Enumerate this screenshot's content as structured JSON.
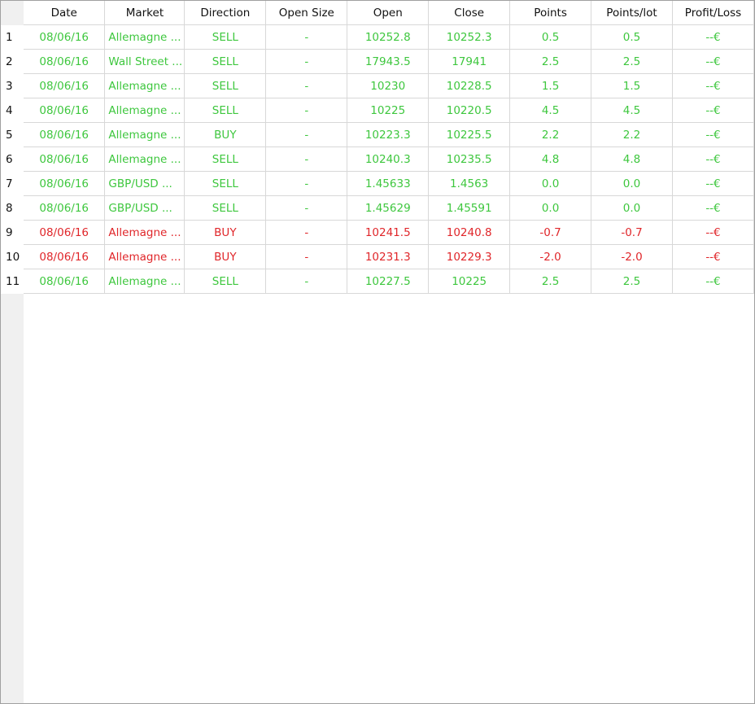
{
  "columns": [
    "Date",
    "Market",
    "Direction",
    "Open Size",
    "Open",
    "Close",
    "Points",
    "Points/lot",
    "Profit/Loss"
  ],
  "colors": {
    "win": "#3ec73e",
    "loss": "#e0262a"
  },
  "rows": [
    {
      "num": "1",
      "result": "win",
      "date": "08/06/16",
      "market": "Allemagne ...",
      "direction": "SELL",
      "open_size": "-",
      "open": "10252.8",
      "close": "10252.3",
      "points": "0.5",
      "points_lot": "0.5",
      "pl": "--€"
    },
    {
      "num": "2",
      "result": "win",
      "date": "08/06/16",
      "market": "Wall Street ...",
      "direction": "SELL",
      "open_size": "-",
      "open": "17943.5",
      "close": "17941",
      "points": "2.5",
      "points_lot": "2.5",
      "pl": "--€"
    },
    {
      "num": "3",
      "result": "win",
      "date": "08/06/16",
      "market": "Allemagne ...",
      "direction": "SELL",
      "open_size": "-",
      "open": "10230",
      "close": "10228.5",
      "points": "1.5",
      "points_lot": "1.5",
      "pl": "--€"
    },
    {
      "num": "4",
      "result": "win",
      "date": "08/06/16",
      "market": "Allemagne ...",
      "direction": "SELL",
      "open_size": "-",
      "open": "10225",
      "close": "10220.5",
      "points": "4.5",
      "points_lot": "4.5",
      "pl": "--€"
    },
    {
      "num": "5",
      "result": "win",
      "date": "08/06/16",
      "market": "Allemagne ...",
      "direction": "BUY",
      "open_size": "-",
      "open": "10223.3",
      "close": "10225.5",
      "points": "2.2",
      "points_lot": "2.2",
      "pl": "--€"
    },
    {
      "num": "6",
      "result": "win",
      "date": "08/06/16",
      "market": "Allemagne ...",
      "direction": "SELL",
      "open_size": "-",
      "open": "10240.3",
      "close": "10235.5",
      "points": "4.8",
      "points_lot": "4.8",
      "pl": "--€"
    },
    {
      "num": "7",
      "result": "win",
      "date": "08/06/16",
      "market": "GBP/USD ...",
      "direction": "SELL",
      "open_size": "-",
      "open": "1.45633",
      "close": "1.4563",
      "points": "0.0",
      "points_lot": "0.0",
      "pl": "--€"
    },
    {
      "num": "8",
      "result": "win",
      "date": "08/06/16",
      "market": "GBP/USD ...",
      "direction": "SELL",
      "open_size": "-",
      "open": "1.45629",
      "close": "1.45591",
      "points": "0.0",
      "points_lot": "0.0",
      "pl": "--€"
    },
    {
      "num": "9",
      "result": "loss",
      "date": "08/06/16",
      "market": "Allemagne ...",
      "direction": "BUY",
      "open_size": "-",
      "open": "10241.5",
      "close": "10240.8",
      "points": "-0.7",
      "points_lot": "-0.7",
      "pl": "--€"
    },
    {
      "num": "10",
      "result": "loss",
      "date": "08/06/16",
      "market": "Allemagne ...",
      "direction": "BUY",
      "open_size": "-",
      "open": "10231.3",
      "close": "10229.3",
      "points": "-2.0",
      "points_lot": "-2.0",
      "pl": "--€"
    },
    {
      "num": "11",
      "result": "win",
      "date": "08/06/16",
      "market": "Allemagne ...",
      "direction": "SELL",
      "open_size": "-",
      "open": "10227.5",
      "close": "10225",
      "points": "2.5",
      "points_lot": "2.5",
      "pl": "--€"
    }
  ]
}
